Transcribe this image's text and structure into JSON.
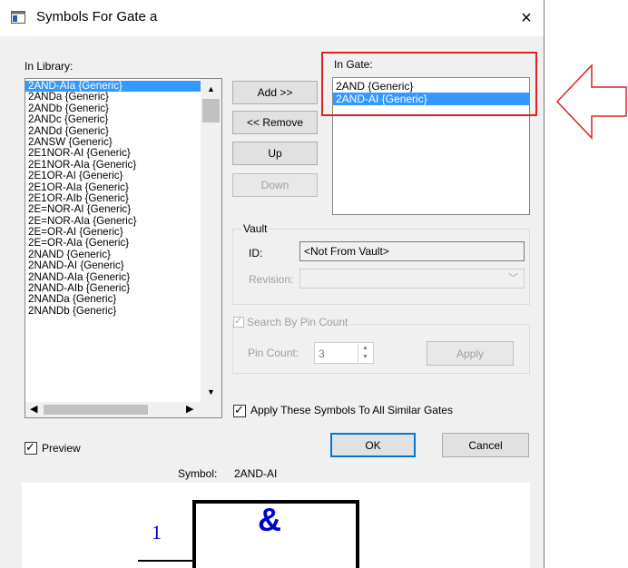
{
  "window": {
    "title": "Symbols For Gate a",
    "close_glyph": "×"
  },
  "library": {
    "label": "In Library:",
    "items": [
      "2AND-AIa {Generic}",
      "2ANDa {Generic}",
      "2ANDb {Generic}",
      "2ANDc {Generic}",
      "2ANDd {Generic}",
      "2ANSW {Generic}",
      "2E1NOR-AI {Generic}",
      "2E1NOR-AIa {Generic}",
      "2E1OR-AI {Generic}",
      "2E1OR-AIa {Generic}",
      "2E1OR-AIb {Generic}",
      "2E=NOR-AI {Generic}",
      "2E=NOR-AIa {Generic}",
      "2E=OR-AI {Generic}",
      "2E=OR-AIa {Generic}",
      "2NAND {Generic}",
      "2NAND-AI {Generic}",
      "2NAND-AIa {Generic}",
      "2NAND-AIb {Generic}",
      "2NANDa {Generic}",
      "2NANDb {Generic}"
    ]
  },
  "gate": {
    "label": "In Gate:",
    "items": [
      "2AND {Generic}",
      "2AND-AI {Generic}"
    ]
  },
  "buttons": {
    "add": "Add >>",
    "remove": "<< Remove",
    "up": "Up",
    "down": "Down",
    "apply": "Apply",
    "ok": "OK",
    "cancel": "Cancel"
  },
  "vault": {
    "caption": "Vault",
    "id_label": "ID:",
    "id_value": "<Not From Vault>",
    "revision_label": "Revision:"
  },
  "search": {
    "caption": "Search By Pin Count",
    "pin_count_label": "Pin Count:",
    "pin_count_value": "3"
  },
  "apply_all": {
    "label": "Apply These Symbols To All Similar Gates",
    "checked": true
  },
  "preview": {
    "label": "Preview",
    "checked": true
  },
  "symbol": {
    "label": "Symbol:",
    "value": "2AND-AI",
    "pin_number": "1",
    "gate_glyph": "&"
  },
  "colors": {
    "highlight": "#3399ff",
    "annotation": "#e02020",
    "pin_text": "#0000cc",
    "default_button_border": "#0078d7"
  }
}
